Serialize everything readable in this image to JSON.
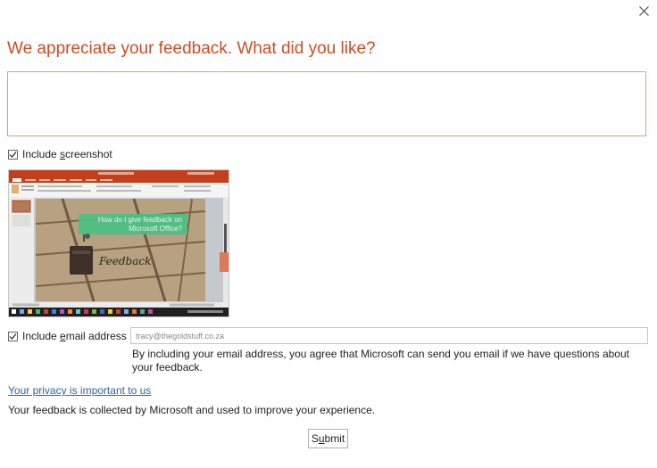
{
  "dialog": {
    "title": "We appreciate your feedback. What did you like?",
    "feedback_value": "",
    "include_screenshot": {
      "checked": true,
      "label_pre": "Include ",
      "label_key": "s",
      "label_post": "creenshot"
    },
    "screenshot_preview": {
      "overlay_line1": "How do I give feedback on",
      "overlay_line2": "Microsoft Office?",
      "sign_text": "Feedback"
    },
    "include_email": {
      "checked": true,
      "label_pre": "Include ",
      "label_key": "e",
      "label_post": "mail address"
    },
    "email_value": "tracy@thegoldstuff.co.za",
    "consent_text": "By including your email address, you agree that Microsoft can send you email if we have questions about your feedback.",
    "privacy_link": "Your privacy is important to us",
    "collected_text": "Your feedback is collected by Microsoft and used to improve your experience.",
    "submit": {
      "pre": "S",
      "key": "u",
      "post": "bmit"
    }
  },
  "colors": {
    "title": "#d04b22",
    "feedback_border": "#e39a84",
    "link": "#2a64a8",
    "ribbon": "#c43e1c",
    "overlay": "#4bbf82"
  },
  "icons": {
    "close": "close-icon",
    "checkbox_check": "checkmark-icon"
  }
}
